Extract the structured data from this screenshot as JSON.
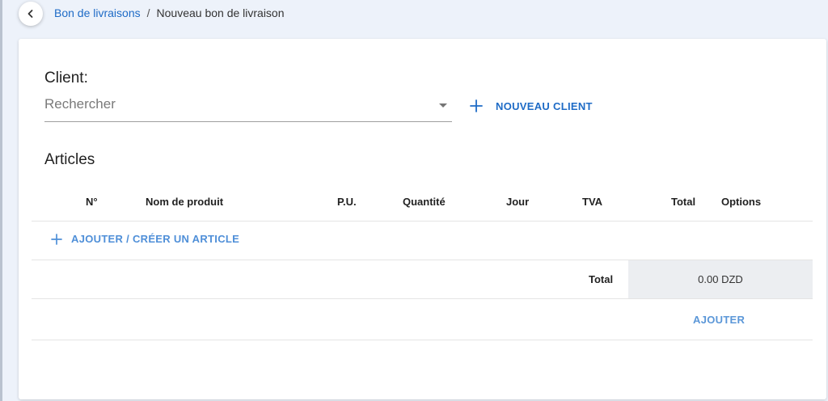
{
  "header": {
    "back_icon": "chevron-left-icon",
    "breadcrumb": {
      "parent": "Bon de livraisons",
      "separator": "/",
      "current": "Nouveau bon de livraison"
    }
  },
  "client": {
    "label": "Client:",
    "search_placeholder": "Rechercher",
    "new_client_label": "NOUVEAU CLIENT"
  },
  "articles": {
    "title": "Articles",
    "columns": [
      "N°",
      "Nom de produit",
      "P.U.",
      "Quantité",
      "Jour",
      "TVA",
      "Total",
      "Options"
    ],
    "add_label": "AJOUTER / CRÉER UN ARTICLE",
    "total_label": "Total",
    "total_value": "0.00 DZD",
    "submit_label": "AJOUTER"
  },
  "colors": {
    "accent": "#1e6bc6",
    "accent_light": "#4f8fd8",
    "background": "#edf2fa",
    "total_cell": "#eceef1"
  }
}
